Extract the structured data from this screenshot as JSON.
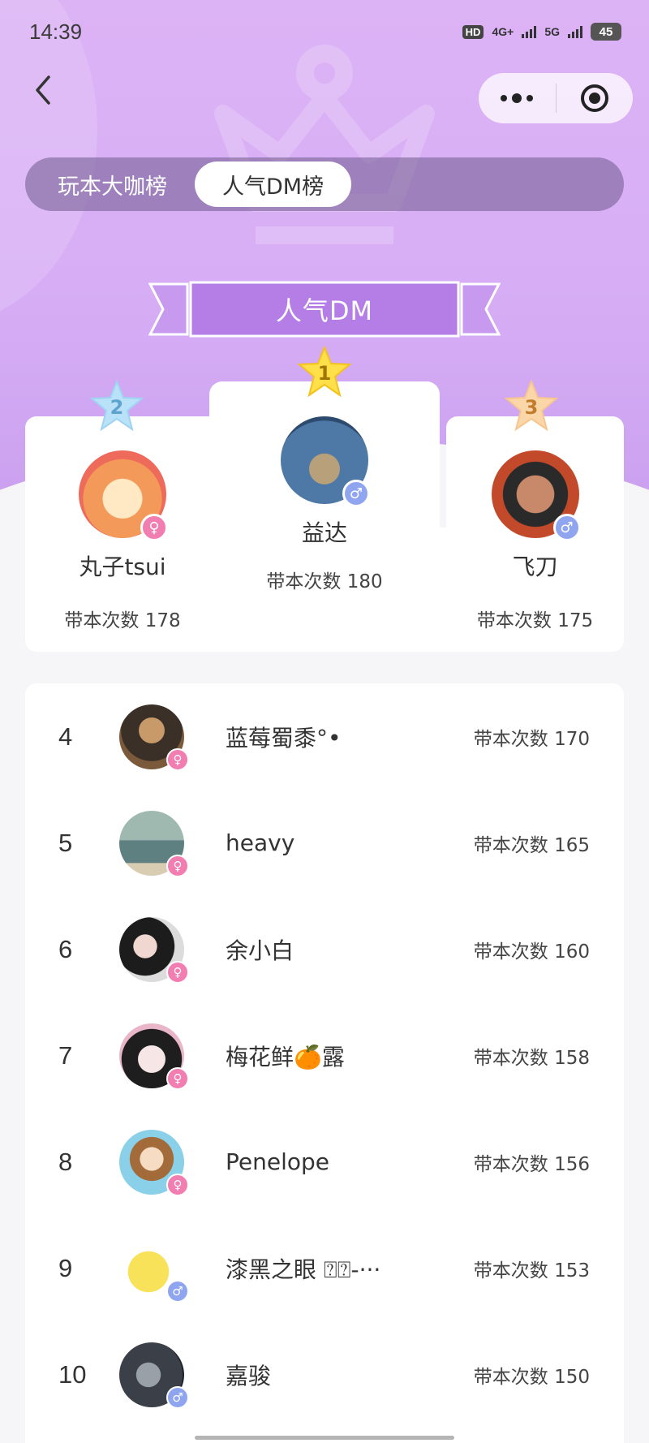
{
  "status_bar": {
    "time": "14:39",
    "hd": "HD",
    "net1": "4G+",
    "net2": "5G",
    "battery": "45"
  },
  "tabs": [
    {
      "label": "玩本大咖榜",
      "active": false
    },
    {
      "label": "人气DM榜",
      "active": true
    }
  ],
  "ribbon_title": "人气DM",
  "podium": [
    {
      "rank": "2",
      "name": "丸子tsui",
      "count": "带本次数 178",
      "gender": "female",
      "star_color": "#9fd3f2"
    },
    {
      "rank": "1",
      "name": "益达",
      "count": "带本次数 180",
      "gender": "male",
      "star_color": "#ffd83a"
    },
    {
      "rank": "3",
      "name": "飞刀",
      "count": "带本次数 175",
      "gender": "male",
      "star_color": "#f7c68f"
    }
  ],
  "list": [
    {
      "rank": "4",
      "name": "蓝莓蜀黍°•",
      "count": "带本次数 170",
      "gender": "female"
    },
    {
      "rank": "5",
      "name": "heavy",
      "count": "带本次数 165",
      "gender": "female"
    },
    {
      "rank": "6",
      "name": "余小白",
      "count": "带本次数 160",
      "gender": "female"
    },
    {
      "rank": "7",
      "name": "梅花鲜🍊露",
      "count": "带本次数 158",
      "gender": "female"
    },
    {
      "rank": "8",
      "name": "Penelope",
      "count": "带本次数 156",
      "gender": "female"
    },
    {
      "rank": "9",
      "name": "漆黑之眼 ⍰⍰-···",
      "count": "带本次数 153",
      "gender": "male"
    },
    {
      "rank": "10",
      "name": "嘉骏",
      "count": "带本次数 150",
      "gender": "male"
    }
  ],
  "gender_symbols": {
    "female": "♀",
    "male": "♂"
  },
  "colors": {
    "accent": "#b070e0",
    "female": "#f27db1",
    "male": "#8fa5f0"
  }
}
